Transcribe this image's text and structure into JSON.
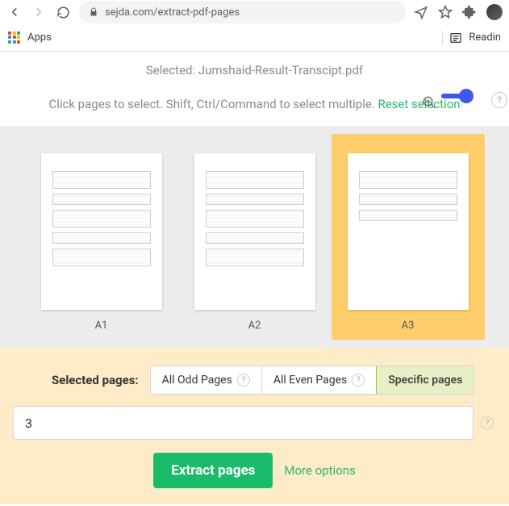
{
  "browser": {
    "url": "sejda.com/extract-pdf-pages",
    "apps_label": "Apps",
    "readinglist_label": "Readin"
  },
  "header": {
    "selected_prefix": "Selected: ",
    "selected_file": "Jumshaid-Result-Transcipt.pdf",
    "instruction": "Click pages to select. Shift, Ctrl/Command to select multiple. ",
    "reset_label": "Reset selection"
  },
  "pages": [
    {
      "label": "A1",
      "selected": false
    },
    {
      "label": "A2",
      "selected": false
    },
    {
      "label": "A3",
      "selected": true
    }
  ],
  "panel": {
    "selected_pages_label": "Selected pages:",
    "segments": {
      "odd": "All Odd Pages",
      "even": "All Even Pages",
      "specific": "Specific pages"
    },
    "active_segment": "specific",
    "input_value": "3",
    "extract_button": "Extract pages",
    "more_options": "More options"
  }
}
